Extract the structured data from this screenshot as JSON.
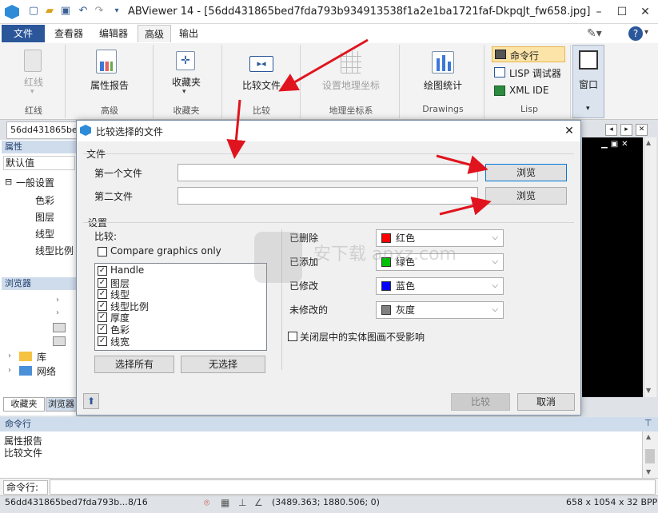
{
  "window": {
    "app_name": "ABViewer 14",
    "title": "ABViewer 14 - [56dd431865bed7fda793b934913538f1a2e1ba1721faf-DkpqJt_fw658.jpg]"
  },
  "ribbon_tabs": [
    "文件",
    "查看器",
    "编辑器",
    "高级",
    "输出"
  ],
  "ribbon": {
    "groups": [
      {
        "button": "红线",
        "group": "红线"
      },
      {
        "button": "属性报告",
        "group": "高级"
      },
      {
        "button": "收藏夹",
        "group": "收藏夹"
      },
      {
        "button": "比较文件",
        "group": "比较"
      },
      {
        "button": "设置地理坐标",
        "group": "地理坐标系"
      },
      {
        "button": "绘图统计",
        "group": "Drawings"
      }
    ],
    "lisp_items": [
      "命令行",
      "LISP 调试器",
      "XML IDE"
    ],
    "lisp_group": "Lisp",
    "window_button": "窗口"
  },
  "doc_tab": "56dd431865bed",
  "left_panel": {
    "properties_header": "属性",
    "default_value": "默认值",
    "general_settings": "一般设置",
    "props": [
      "色彩",
      "图层",
      "线型",
      "线型比例"
    ],
    "browser_header": "浏览器",
    "tree": [
      "库",
      "网络"
    ],
    "bottom_tabs": [
      "收藏夹",
      "浏览器"
    ]
  },
  "dialog": {
    "title": "比较选择的文件",
    "files_section": "文件",
    "first_file_label": "第一个文件",
    "second_file_label": "第二文件",
    "browse": "浏览",
    "settings_section": "设置",
    "compare_label": "比较:",
    "compare_graphics_only": "Compare graphics only",
    "items": [
      "Handle",
      "图层",
      "线型",
      "线型比例",
      "厚度",
      "色彩",
      "线宽"
    ],
    "select_all": "选择所有",
    "select_none": "无选择",
    "deleted_label": "已删除",
    "added_label": "已添加",
    "modified_label": "已修改",
    "unmodified_label": "未修改的",
    "deleted_color": {
      "name": "红色",
      "hex": "#ff0000"
    },
    "added_color": {
      "name": "绿色",
      "hex": "#00c000"
    },
    "modified_color": {
      "name": "蓝色",
      "hex": "#0000ff"
    },
    "unmodified_color": {
      "name": "灰度",
      "hex": "#808080"
    },
    "closed_layers": "关闭层中的实体图画不受影响",
    "compare_button": "比较",
    "cancel_button": "取消"
  },
  "command_panel": {
    "header": "命令行",
    "output": [
      "属性报告",
      "比较文件"
    ],
    "prompt": "命令行:"
  },
  "status": {
    "file": "56dd431865bed7fda793b...",
    "pages": "8/16",
    "coords": "(3489.363; 1880.506; 0)",
    "size": "658 x 1054 x 32 BPP"
  },
  "watermark": "安下载 anxz.com",
  "colors": {
    "accent": "#2b579a",
    "arrow": "#e0141e"
  }
}
